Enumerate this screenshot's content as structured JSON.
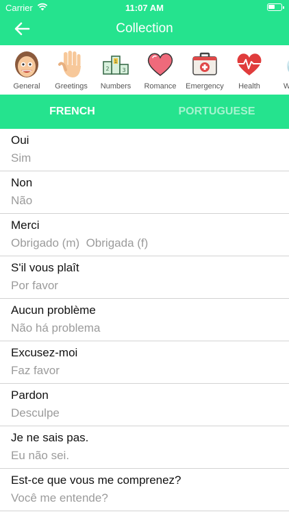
{
  "status_bar": {
    "carrier": "Carrier",
    "time": "11:07 AM"
  },
  "header": {
    "title": "Collection"
  },
  "categories": [
    {
      "label": "General",
      "icon": "face-icon"
    },
    {
      "label": "Greetings",
      "icon": "waving-hand-icon"
    },
    {
      "label": "Numbers",
      "icon": "podium-icon"
    },
    {
      "label": "Romance",
      "icon": "heart-icon"
    },
    {
      "label": "Emergency",
      "icon": "first-aid-kit-icon"
    },
    {
      "label": "Health",
      "icon": "heartbeat-icon"
    },
    {
      "label": "We",
      "icon": "weather-icon"
    }
  ],
  "tabs": [
    {
      "label": "FRENCH",
      "active": true
    },
    {
      "label": "PORTUGUESE",
      "active": false
    }
  ],
  "phrases": [
    {
      "french": "Oui",
      "portuguese": "Sim"
    },
    {
      "french": "Non",
      "portuguese": "Não"
    },
    {
      "french": "Merci",
      "portuguese": "Obrigado (m)  Obrigada (f)"
    },
    {
      "french": "S'il vous plaît",
      "portuguese": "Por favor"
    },
    {
      "french": "Aucun problème",
      "portuguese": "Não há problema"
    },
    {
      "french": "Excusez-moi",
      "portuguese": "Faz favor"
    },
    {
      "french": "Pardon",
      "portuguese": "Desculpe"
    },
    {
      "french": "Je ne sais pas.",
      "portuguese": "Eu não sei."
    },
    {
      "french": "Est-ce que vous me comprenez?",
      "portuguese": "Você me entende?"
    }
  ],
  "colors": {
    "accent": "#25e38e",
    "tab_inactive": "#a6f3cf",
    "secondary_text": "#9b9b9b"
  }
}
